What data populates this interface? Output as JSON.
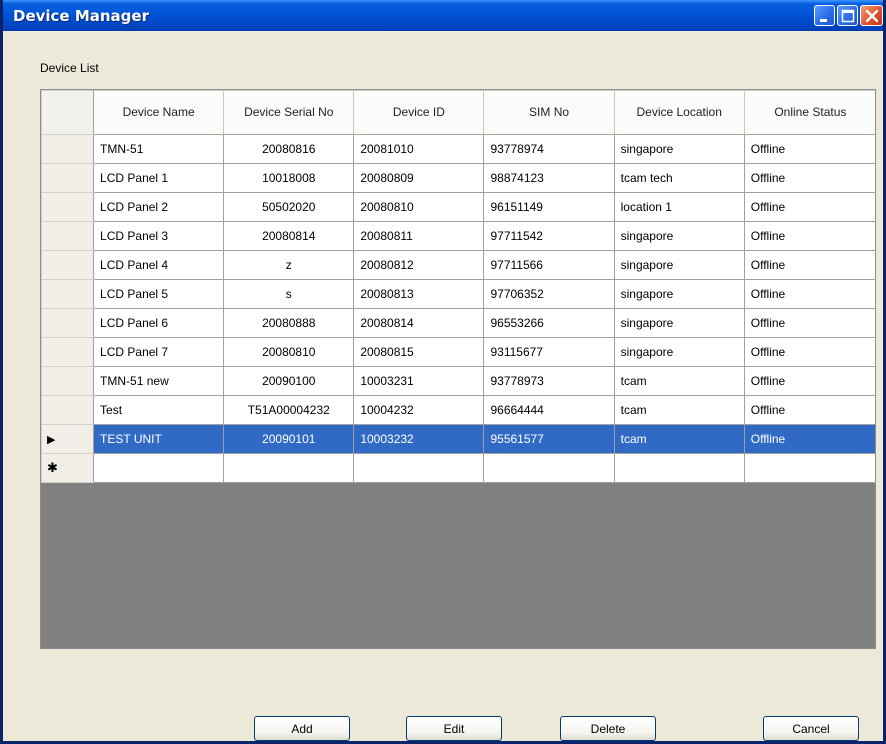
{
  "window": {
    "title": "Device Manager"
  },
  "group": {
    "label": "Device List"
  },
  "grid": {
    "columns": [
      "Device Name",
      "Device Serial No",
      "Device ID",
      "SIM No",
      "Device Location",
      "Online Status"
    ],
    "rows": [
      [
        "TMN-51",
        "20080816",
        "20081010",
        "93778974",
        "singapore",
        "Offline"
      ],
      [
        "LCD Panel 1",
        "10018008",
        "20080809",
        "98874123",
        "tcam tech",
        "Offline"
      ],
      [
        "LCD Panel 2",
        "50502020",
        "20080810",
        "96151149",
        "location 1",
        "Offline"
      ],
      [
        "LCD Panel 3",
        "20080814",
        "20080811",
        "97711542",
        "singapore",
        "Offline"
      ],
      [
        "LCD Panel 4",
        "z",
        "20080812",
        "97711566",
        "singapore",
        "Offline"
      ],
      [
        "LCD Panel 5",
        "s",
        "20080813",
        "97706352",
        "singapore",
        "Offline"
      ],
      [
        "LCD Panel 6",
        "20080888",
        "20080814",
        "96553266",
        "singapore",
        "Offline"
      ],
      [
        "LCD Panel 7",
        "20080810",
        "20080815",
        "93115677",
        "singapore",
        "Offline"
      ],
      [
        "TMN-51 new",
        "20090100",
        "10003231",
        "93778973",
        "tcam",
        "Offline"
      ],
      [
        "Test",
        "T51A00004232",
        "10004232",
        "96664444",
        "tcam",
        "Offline"
      ],
      [
        "TEST UNIT",
        "20090101",
        "10003232",
        "95561577",
        "tcam",
        "Offline"
      ]
    ],
    "selected_row_index": 10,
    "selected_marker": "▶",
    "new_row_marker": "✱"
  },
  "buttons": {
    "add": "Add",
    "edit": "Edit",
    "delete": "Delete",
    "cancel": "Cancel"
  },
  "colors": {
    "selection": "#316ac5",
    "titlebar": "#0256d9",
    "grid_background": "#808080"
  }
}
